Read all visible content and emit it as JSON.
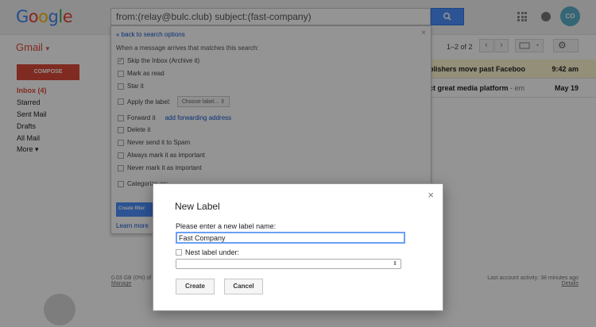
{
  "header": {
    "logo_letters": [
      {
        "ch": "G",
        "color": "#4285f4"
      },
      {
        "ch": "o",
        "color": "#ea4335"
      },
      {
        "ch": "o",
        "color": "#fbbc05"
      },
      {
        "ch": "g",
        "color": "#4285f4"
      },
      {
        "ch": "l",
        "color": "#34a853"
      },
      {
        "ch": "e",
        "color": "#ea4335"
      }
    ],
    "search_query": "from:(relay@bulc.club) subject:(fast-company)",
    "avatar_text": "CO"
  },
  "toolbar": {
    "app_label": "Gmail",
    "app_caret": "▾",
    "range": "1–2 of 2",
    "prev": "‹",
    "next": "›",
    "settings": "⚙"
  },
  "sidebar": {
    "compose": "COMPOSE",
    "items": [
      {
        "label": "Inbox (4)",
        "active": true
      },
      {
        "label": "Starred"
      },
      {
        "label": "Sent Mail"
      },
      {
        "label": "Drafts"
      },
      {
        "label": "All Mail"
      },
      {
        "label": "More ▾"
      }
    ]
  },
  "messages": [
    {
      "subject": "blishers move past Faceboo",
      "snippet": "",
      "time": "9:42 am",
      "unread": true
    },
    {
      "subject": "ct great media platform",
      "snippet": " - em",
      "time": "May 19",
      "unread": false
    }
  ],
  "filter": {
    "back": "« back to search options",
    "close": "×",
    "heading": "When a message arrives that matches this search:",
    "options": [
      {
        "label": "Skip the Inbox (Archive it)",
        "checked": true
      },
      {
        "label": "Mark as read"
      },
      {
        "label": "Star it"
      },
      {
        "label": "Apply the label:",
        "select": "Choose label..."
      },
      {
        "label": "Forward it",
        "link": "add forwarding address"
      },
      {
        "label": "Delete it"
      },
      {
        "label": "Never send it to Spam"
      },
      {
        "label": "Always mark it as important"
      },
      {
        "label": "Never mark it as important"
      },
      {
        "label": "Categorize as:"
      }
    ],
    "create_label": "Create filter",
    "learn_more": "Learn more"
  },
  "footer": {
    "storage": "0.03 GB (0%) of",
    "manage": "Manage",
    "activity": "Last account activity: 38 minutes ago",
    "details": "Details"
  },
  "dialog": {
    "title": "New Label",
    "close": "×",
    "prompt": "Please enter a new label name:",
    "name_value": "Fast Company",
    "nest_label": "Nest label under:",
    "parent_value": "",
    "create": "Create",
    "cancel": "Cancel"
  }
}
